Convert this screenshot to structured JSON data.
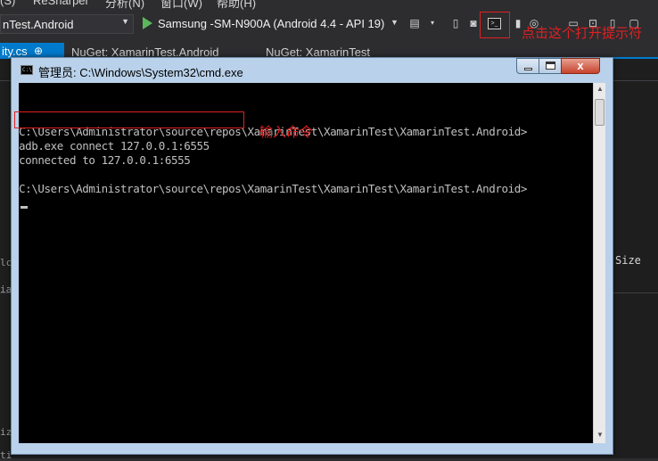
{
  "menubar": {
    "items": [
      "(S)",
      "ReSharper",
      "分析(N)",
      "窗口(W)",
      "帮助(H)"
    ]
  },
  "toolbar": {
    "project": "nTest.Android",
    "device": "Samsung -SM-N900A (Android 4.4 - API 19)",
    "annotation": "点击这个打开提示符"
  },
  "tabs": {
    "active": "ity.cs",
    "active_pin": "⊕",
    "items": [
      "NuGet: XamarinTest.Android",
      "NuGet: XamarinTest"
    ]
  },
  "editor": {
    "size_label": "Size",
    "edge_labels": [
      "lc",
      "ia",
      "iz",
      "ti"
    ]
  },
  "cmd": {
    "title": "管理员: C:\\Windows\\System32\\cmd.exe",
    "icon_text": "C:\\",
    "lines": [
      "C:\\Users\\Administrator\\source\\repos\\XamarinTest\\XamarinTest\\XamarinTest.Android>",
      "adb.exe connect 127.0.0.1:6555",
      "connected to 127.0.0.1:6555",
      "C:\\Users\\Administrator\\source\\repos\\XamarinTest\\XamarinTest\\XamarinTest.Android>"
    ],
    "annotation": "输入命令",
    "close_glyph": "x"
  },
  "colors": {
    "annotation": "#e02020",
    "vs_background": "#2d2d30",
    "accent": "#007acc",
    "console_bg": "#000000",
    "console_text": "#c0c0c0"
  }
}
